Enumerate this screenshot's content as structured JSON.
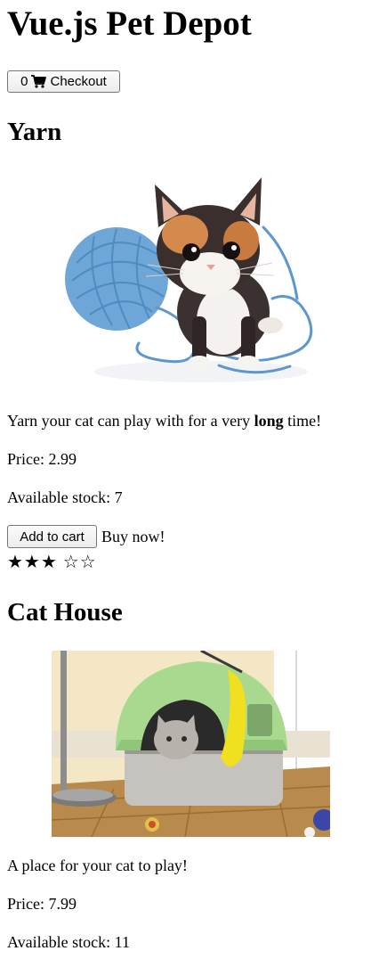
{
  "header": {
    "title": "Vue.js Pet Depot"
  },
  "cart": {
    "count": "0",
    "checkout_label": "Checkout",
    "icon": "cart-icon"
  },
  "products": [
    {
      "title": "Yarn",
      "description_before": "Yarn your cat can play with for a very ",
      "description_bold": "long",
      "description_after": " time!",
      "price_label": "Price: 2.99",
      "stock_label": "Available stock: 7",
      "add_to_cart_label": "Add to cart",
      "buy_now_label": "Buy now!",
      "rating": 3,
      "rating_max": 5,
      "filled_stars": "★★★",
      "empty_stars": "☆☆"
    },
    {
      "title": "Cat House",
      "description": "A place for your cat to play!",
      "price_label": "Price: 7.99",
      "stock_label": "Available stock: 11"
    }
  ]
}
